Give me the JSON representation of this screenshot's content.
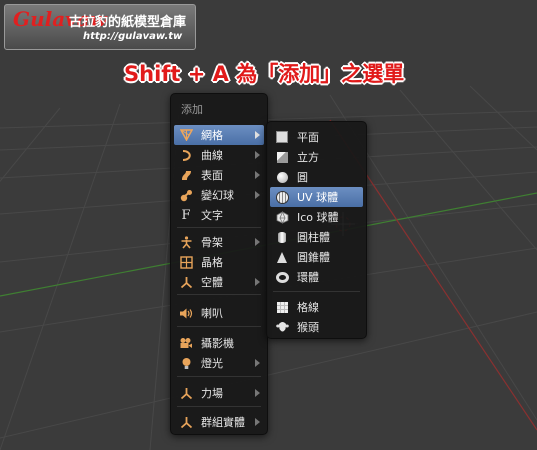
{
  "logo": {
    "mark": "Gulavaw",
    "title": "古拉豹的紙模型倉庫",
    "url": "http://gulavaw.tw"
  },
  "caption": "Shift + A 為「添加」之選單",
  "add_menu": {
    "title": "添加",
    "items": [
      {
        "label": "網格",
        "icon": "mesh-icon",
        "submenu": true,
        "active": true
      },
      {
        "label": "曲線",
        "icon": "curve-icon",
        "submenu": true
      },
      {
        "label": "表面",
        "icon": "surface-icon",
        "submenu": true
      },
      {
        "label": "變幻球",
        "icon": "metaball-icon",
        "submenu": true
      },
      {
        "label": "文字",
        "icon": "text-icon",
        "submenu": false
      },
      {
        "label": "骨架",
        "icon": "armature-icon",
        "submenu": true
      },
      {
        "label": "晶格",
        "icon": "lattice-icon",
        "submenu": false
      },
      {
        "label": "空體",
        "icon": "empty-icon",
        "submenu": true
      },
      {
        "label": "喇叭",
        "icon": "speaker-icon",
        "submenu": false
      },
      {
        "label": "攝影機",
        "icon": "camera-icon",
        "submenu": false
      },
      {
        "label": "燈光",
        "icon": "lamp-icon",
        "submenu": true
      },
      {
        "label": "力場",
        "icon": "force-field-icon",
        "submenu": true
      },
      {
        "label": "群組實體",
        "icon": "group-instance-icon",
        "submenu": true
      }
    ]
  },
  "mesh_menu": {
    "items": [
      {
        "label": "平面",
        "icon": "plane-icon"
      },
      {
        "label": "立方",
        "icon": "cube-icon"
      },
      {
        "label": "圓",
        "icon": "circle-icon"
      },
      {
        "label": "UV 球體",
        "icon": "uv-sphere-icon",
        "active": true
      },
      {
        "label": "Ico 球體",
        "icon": "ico-sphere-icon"
      },
      {
        "label": "圓柱體",
        "icon": "cylinder-icon"
      },
      {
        "label": "圓錐體",
        "icon": "cone-icon"
      },
      {
        "label": "環體",
        "icon": "torus-icon"
      },
      {
        "label": "格線",
        "icon": "grid-icon"
      },
      {
        "label": "猴頭",
        "icon": "monkey-icon"
      }
    ]
  },
  "colors": {
    "viewport_bg": "#3b3b3b",
    "grid_line": "#4a4a4a",
    "x_axis": "#8a3030",
    "y_axis": "#3f7f32",
    "highlight": "#5a7fb6",
    "icon_orange": "#e8a45a",
    "caption_red": "#e11a1a"
  }
}
